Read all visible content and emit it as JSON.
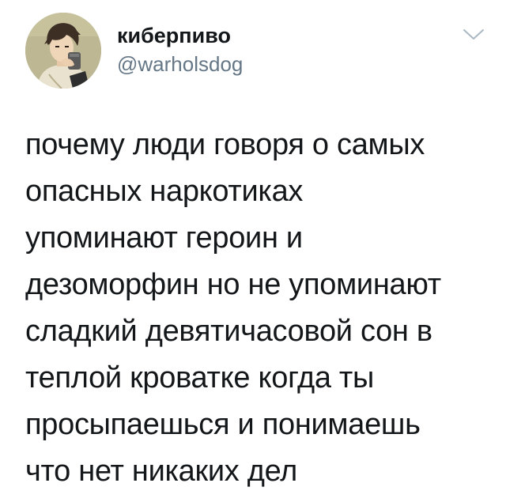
{
  "tweet": {
    "author": {
      "display_name": "киберпиво",
      "handle": "@warholsdog",
      "avatar_icon": "avatar-illustration-icon"
    },
    "menu_icon": "chevron-down-icon",
    "text_lines": [
      "почему люди говоря о самых",
      "опасных наркотиках",
      "упоминают героин и",
      "дезоморфин но не упоминают",
      "сладкий девятичасовой сон в",
      "теплой кроватке когда ты",
      "просыпаешься и понимаешь",
      "что нет никаких дел"
    ]
  },
  "colors": {
    "text_primary": "#14171a",
    "text_secondary": "#657786",
    "chevron": "#aab8c2",
    "background": "#ffffff"
  }
}
